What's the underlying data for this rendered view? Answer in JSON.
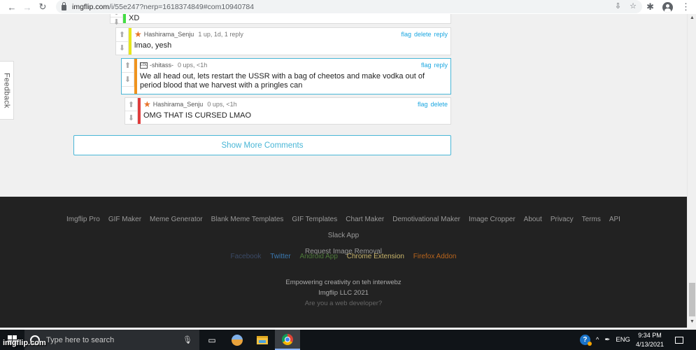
{
  "browser": {
    "url_host": "imgflip.com",
    "url_path": "/i/55e247?nerp=1618374849#com10940784",
    "icons": [
      "back-icon",
      "forward-icon",
      "reload-icon",
      "lock-icon",
      "install-icon",
      "bookmark-star-icon",
      "extensions-puzzle-icon",
      "profile-avatar-icon",
      "menu-kebab-icon"
    ]
  },
  "feedback_tab": "Feedback",
  "comments": [
    {
      "partial": true,
      "text": "XD",
      "bar_color": "#44dd44"
    },
    {
      "user": "Hashirama_Senju",
      "meta": "1 up, 1d, 1 reply",
      "text": "lmao, yesh",
      "actions": [
        "flag",
        "delete",
        "reply"
      ],
      "bar_color": "#e6e61a",
      "icon": "star-icon"
    },
    {
      "user": "-shitass-",
      "meta": "0 ups, <1h",
      "text": "We all head out, lets restart the USSR with a bag of cheetos and make vodka out of period blood that we harvest with a pringles can",
      "actions": [
        "flag",
        "reply"
      ],
      "bar_color": "#f0931e",
      "icon": "lol-icon",
      "icon_text": "LOL",
      "highlighted": true
    },
    {
      "user": "Hashirama_Senju",
      "meta": "0 ups, <1h",
      "text": "OMG THAT IS CURSED LMAO",
      "actions": [
        "flag",
        "delete"
      ],
      "bar_color": "#e03c3c",
      "icon": "star-icon"
    }
  ],
  "show_more_label": "Show More Comments",
  "footer": {
    "links": [
      "Imgflip Pro",
      "GIF Maker",
      "Meme Generator",
      "Blank Meme Templates",
      "GIF Templates",
      "Chart Maker",
      "Demotivational Maker",
      "Image Cropper",
      "About",
      "Privacy",
      "Terms",
      "API",
      "Slack App",
      "Request Image Removal"
    ],
    "social": [
      {
        "label": "Facebook",
        "color": "#3b4a66"
      },
      {
        "label": "Twitter",
        "color": "#3a78b0"
      },
      {
        "label": "Android App",
        "color": "#4e7a3a"
      },
      {
        "label": "Chrome Extension",
        "color": "#c8b46a"
      },
      {
        "label": "Firefox Addon",
        "color": "#b8641c"
      }
    ],
    "tagline": "Empowering creativity on teh interwebz",
    "copyright": "Imgflip LLC 2021",
    "dev_link": "Are you a web developer?"
  },
  "taskbar": {
    "search_placeholder": "Type here to search",
    "watermark": "imgflip.com",
    "language": "ENG",
    "time": "9:34 PM",
    "date": "4/13/2021"
  }
}
